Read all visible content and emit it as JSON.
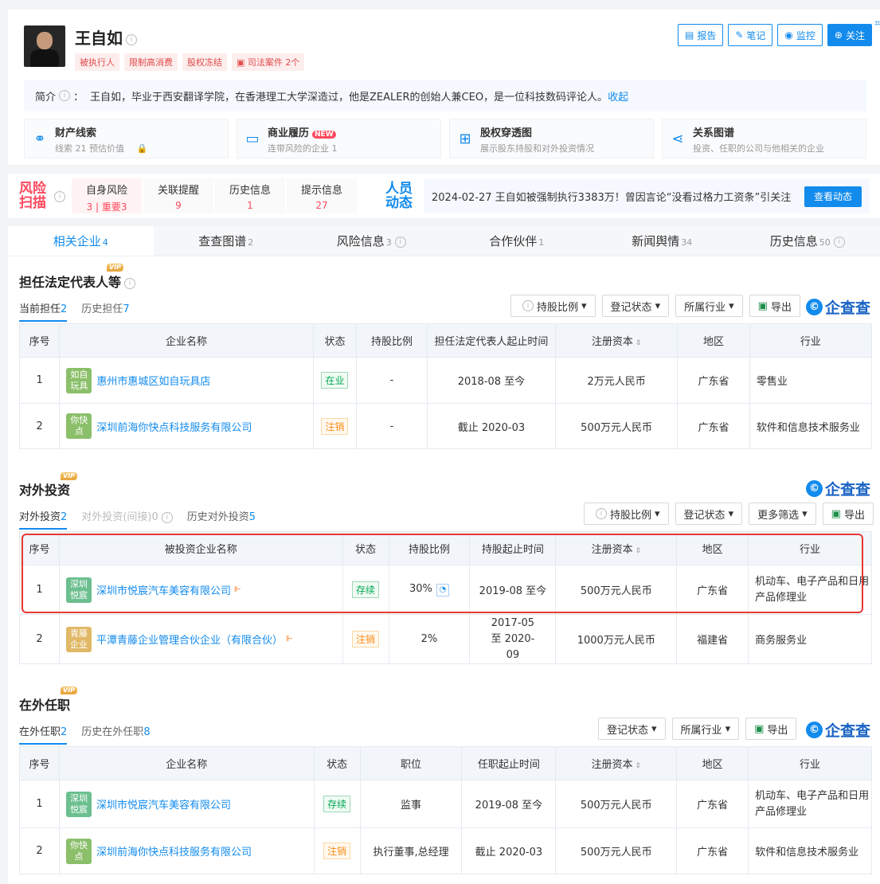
{
  "header": {
    "name": "王自如",
    "tags": [
      "被执行人",
      "限制高消费",
      "股权冻结",
      "司法案件 2个"
    ],
    "actions": [
      "报告",
      "笔记",
      "监控",
      "关注"
    ],
    "intro_label": "简介",
    "intro_text": "王自如，毕业于西安翻译学院，在香港理工大学深造过，他是ZEALER的创始人兼CEO，是一位科技数码评论人。",
    "intro_link": "收起"
  },
  "features": [
    {
      "title": "财产线索",
      "sub": "线索 21  预估价值"
    },
    {
      "title": "商业履历",
      "badge": "NEW",
      "sub": "连带风险的企业 1"
    },
    {
      "title": "股权穿透图",
      "sub": "展示股东持股和对外投资情况"
    },
    {
      "title": "关系图谱",
      "sub": "投资、任职的公司与他相关的企业"
    }
  ],
  "risk": {
    "logo": "风险\n扫描",
    "cells": [
      {
        "label": "自身风险",
        "value": "3 | 重要3"
      },
      {
        "label": "关联提醒",
        "value": "9"
      },
      {
        "label": "历史信息",
        "value": "1"
      },
      {
        "label": "提示信息",
        "value": "27"
      }
    ],
    "people_logo": "人员\n动态",
    "news": "2024-02-27 王自如被强制执行3383万！曾因言论“没看过格力工资条”引关注",
    "news_btn": "查看动态"
  },
  "tabs": [
    {
      "label": "相关企业",
      "count": "4"
    },
    {
      "label": "查查图谱",
      "count": "2"
    },
    {
      "label": "风险信息",
      "count": "3"
    },
    {
      "label": "合作伙伴",
      "count": "1"
    },
    {
      "label": "新闻舆情",
      "count": "34"
    },
    {
      "label": "历史信息",
      "count": "50"
    }
  ],
  "brand": "企查查",
  "vip": "VIP",
  "sec1": {
    "title": "担任法定代表人等",
    "subtabs": [
      {
        "label": "当前担任",
        "n": "2"
      },
      {
        "label": "历史担任",
        "n": "7"
      }
    ],
    "filters": [
      "持股比例",
      "登记状态",
      "所属行业",
      "导出"
    ],
    "headers": [
      "序号",
      "企业名称",
      "状态",
      "持股比例",
      "担任法定代表人起止时间",
      "注册资本",
      "地区",
      "行业"
    ],
    "rows": [
      {
        "idx": "1",
        "logo": "如自\n玩具",
        "logo_color": "#8bbf6a",
        "name": "惠州市惠城区如自玩具店",
        "status": "在业",
        "ratio": "-",
        "time": "2018-08 至今",
        "capital": "2万元人民币",
        "region": "广东省",
        "industry": "零售业"
      },
      {
        "idx": "2",
        "logo": "你快\n点",
        "logo_color": "#8bbf6a",
        "name": "深圳前海你快点科技服务有限公司",
        "status": "注销",
        "ratio": "-",
        "time": "截止 2020-03",
        "capital": "500万元人民币",
        "region": "广东省",
        "industry": "软件和信息技术服务业"
      }
    ]
  },
  "sec2": {
    "title": "对外投资",
    "subtabs": [
      {
        "label": "对外投资",
        "n": "2"
      },
      {
        "label": "对外投资(间接)",
        "n": "0"
      },
      {
        "label": "历史对外投资",
        "n": "5"
      }
    ],
    "filters": [
      "持股比例",
      "登记状态",
      "更多筛选",
      "导出"
    ],
    "headers": [
      "序号",
      "被投资企业名称",
      "状态",
      "持股比例",
      "持股起止时间",
      "注册资本",
      "地区",
      "行业"
    ],
    "rows": [
      {
        "idx": "1",
        "logo": "深圳\n悦宸",
        "logo_color": "#6cbf8f",
        "name": "深圳市悦宸汽车美容有限公司",
        "status": "存续",
        "ratio": "30%",
        "time": "2019-08 至今",
        "capital": "500万元人民币",
        "region": "广东省",
        "industry": "机动车、电子产品和日用产品修理业"
      },
      {
        "idx": "2",
        "logo": "青藤\n企业",
        "logo_color": "#e0b866",
        "name": "平潭青藤企业管理合伙企业（有限合伙）",
        "status": "注销",
        "ratio": "2%",
        "time": "2017-05 至 2020-09",
        "capital": "1000万元人民币",
        "region": "福建省",
        "industry": "商务服务业"
      }
    ]
  },
  "sec3": {
    "title": "在外任职",
    "subtabs": [
      {
        "label": "在外任职",
        "n": "2"
      },
      {
        "label": "历史在外任职",
        "n": "8"
      }
    ],
    "filters": [
      "登记状态",
      "所属行业",
      "导出"
    ],
    "headers": [
      "序号",
      "企业名称",
      "状态",
      "职位",
      "任职起止时间",
      "注册资本",
      "地区",
      "行业"
    ],
    "rows": [
      {
        "idx": "1",
        "logo": "深圳\n悦宸",
        "logo_color": "#6cbf8f",
        "name": "深圳市悦宸汽车美容有限公司",
        "status": "存续",
        "ratio": "监事",
        "time": "2019-08 至今",
        "capital": "500万元人民币",
        "region": "广东省",
        "industry": "机动车、电子产品和日用产品修理业"
      },
      {
        "idx": "2",
        "logo": "你快\n点",
        "logo_color": "#8bbf6a",
        "name": "深圳前海你快点科技服务有限公司",
        "status": "注销",
        "ratio": "执行董事,总经理",
        "time": "截止 2020-03",
        "capital": "500万元人民币",
        "region": "广东省",
        "industry": "软件和信息技术服务业"
      }
    ]
  }
}
